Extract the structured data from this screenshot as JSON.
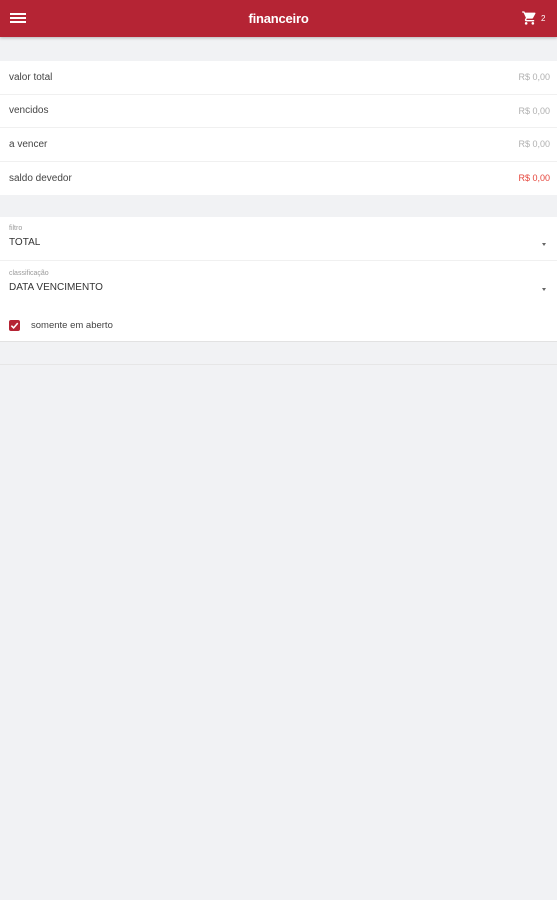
{
  "app_bar": {
    "title": "financeiro",
    "background_color": "#b52434",
    "menu_icon": "menu-icon",
    "cart_icon": "cart-icon",
    "cart_count": "2"
  },
  "summary": {
    "rows": [
      {
        "label": "valor total",
        "value": "R$ 0,00"
      },
      {
        "label": "vencidos",
        "value": "R$ 0,00"
      },
      {
        "label": "a vencer",
        "value": "R$ 0,00"
      },
      {
        "label": "saldo devedor",
        "value": "R$ 0,00",
        "value_color": "#e5453b"
      }
    ]
  },
  "filters": {
    "filter": {
      "label": "filtro",
      "value": "TOTAL"
    },
    "sort": {
      "label": "classificação",
      "value": "DATA VENCIMENTO"
    },
    "only_open": {
      "label": "somente em aberto",
      "checked": true
    }
  }
}
